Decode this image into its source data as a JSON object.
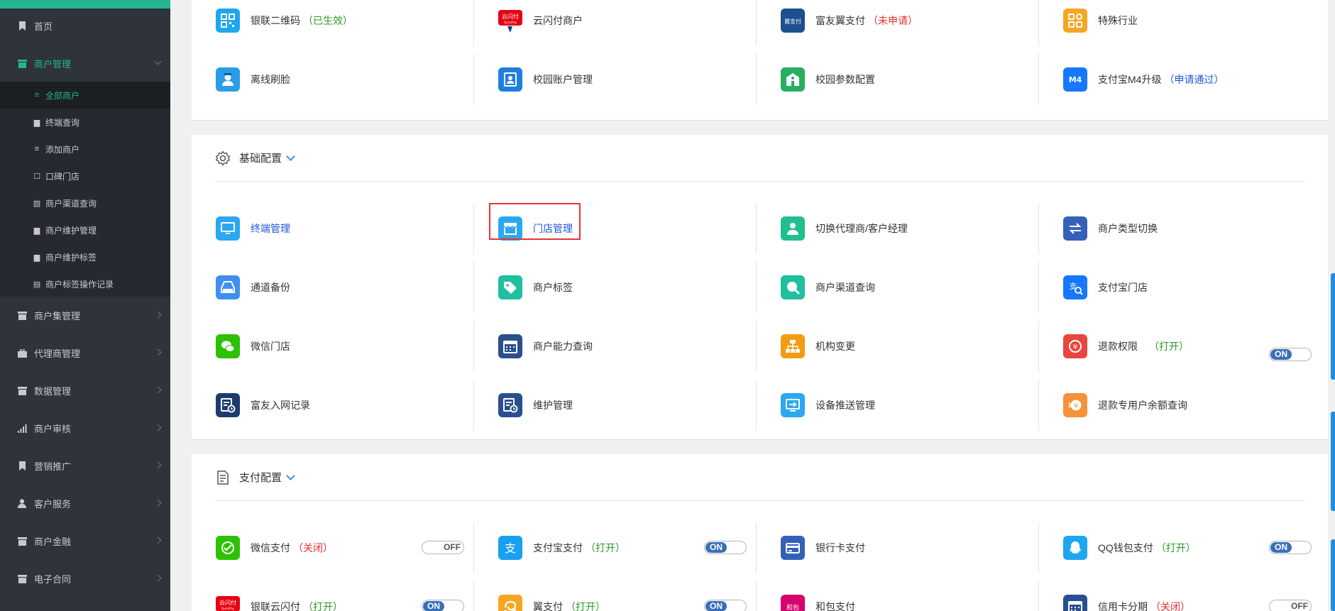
{
  "sidebar": {
    "items": [
      {
        "label": "首页",
        "icon": "bookmark-icon"
      },
      {
        "label": "商户管理",
        "icon": "store-icon"
      },
      {
        "label": "商户集管理",
        "icon": "store-icon"
      },
      {
        "label": "代理商管理",
        "icon": "briefcase-icon"
      },
      {
        "label": "数据管理",
        "icon": "store-icon"
      },
      {
        "label": "商户审核",
        "icon": "signal-icon"
      },
      {
        "label": "营销推广",
        "icon": "bookmark-icon"
      },
      {
        "label": "客户服务",
        "icon": "user-icon"
      },
      {
        "label": "商户金融",
        "icon": "store-icon"
      },
      {
        "label": "电子合同",
        "icon": "store-icon"
      }
    ],
    "subitems": [
      {
        "label": "全部商户",
        "icon": "list-icon"
      },
      {
        "label": "终端查询",
        "icon": "store-icon"
      },
      {
        "label": "添加商户",
        "icon": "list-icon"
      },
      {
        "label": "口碑门店",
        "icon": "square-icon"
      },
      {
        "label": "商户渠道查询",
        "icon": "image-icon"
      },
      {
        "label": "商户维护管理",
        "icon": "store-icon"
      },
      {
        "label": "商户维护标签",
        "icon": "store-icon"
      },
      {
        "label": "商户标签操作记录",
        "icon": "file-icon"
      }
    ]
  },
  "top_section": {
    "cells": [
      {
        "label": "银联二维码",
        "status": "（已生效）",
        "status_color": "green",
        "icon": "qrcode-icon",
        "color": "#1ea7f0"
      },
      {
        "label": "云闪付商户",
        "status": "",
        "icon": "unionpay-icon",
        "color": "#e60012"
      },
      {
        "label": "富友翼支付",
        "status": "（未申请）",
        "status_color": "red",
        "icon": "bestpay-icon",
        "color": "#1d4f91"
      },
      {
        "label": "特殊行业",
        "status": "",
        "icon": "grid-icon",
        "color": "#f5a623"
      },
      {
        "label": "离线刷脸",
        "status": "",
        "icon": "face-icon",
        "color": "#2a9de8"
      },
      {
        "label": "校园账户管理",
        "status": "",
        "icon": "contact-card-icon",
        "color": "#1e7fe0"
      },
      {
        "label": "校园参数配置",
        "status": "",
        "icon": "school-icon",
        "color": "#27ae60"
      },
      {
        "label": "支付宝M4升级",
        "status": "（申请通过）",
        "status_color": "blue",
        "icon": "m4-icon",
        "color": "#1677ff"
      }
    ]
  },
  "basic_section": {
    "title": "基础配置",
    "icon": "gear-icon",
    "cells": [
      {
        "label": "终端管理",
        "link": true,
        "icon": "monitor-icon",
        "color": "#2aa8f2"
      },
      {
        "label": "门店管理",
        "link": true,
        "icon": "shop-icon",
        "color": "#2aa8f2"
      },
      {
        "label": "切换代理商/客户经理",
        "icon": "person-icon",
        "color": "#1fbf8f"
      },
      {
        "label": "商户类型切换",
        "icon": "swap-icon",
        "color": "#3461b8"
      },
      {
        "label": "通道备份",
        "icon": "drive-icon",
        "color": "#3f8ff0"
      },
      {
        "label": "商户标签",
        "icon": "tag-icon",
        "color": "#1fbf9f"
      },
      {
        "label": "商户渠道查询",
        "icon": "search-icon",
        "color": "#1fbf9f"
      },
      {
        "label": "支付宝门店",
        "icon": "alipay-search-icon",
        "color": "#1677ff"
      },
      {
        "label": "微信门店",
        "icon": "wechat-icon",
        "color": "#2dc100"
      },
      {
        "label": "商户能力查询",
        "icon": "calendar-icon",
        "color": "#2b4f8e"
      },
      {
        "label": "机构变更",
        "icon": "org-chart-icon",
        "color": "#f39c12"
      },
      {
        "label": "退款权限",
        "status": "（打开）",
        "status_color": "green",
        "toggle": "ON",
        "icon": "refund-icon",
        "color": "#e9463d"
      },
      {
        "label": "富友入网记录",
        "icon": "record-icon",
        "color": "#1d3c6e"
      },
      {
        "label": "维护管理",
        "icon": "record-icon",
        "color": "#2b4f8e"
      },
      {
        "label": "设备推送管理",
        "icon": "push-icon",
        "color": "#2aa8f2"
      },
      {
        "label": "退款专用户余额查询",
        "icon": "refund-balance-icon",
        "color": "#f5923a"
      }
    ]
  },
  "pay_section": {
    "title": "支付配置",
    "icon": "document-icon",
    "cells": [
      {
        "label": "微信支付",
        "status": "（关闭）",
        "status_color": "red",
        "toggle": "OFF",
        "icon": "wechat-pay-icon",
        "color": "#2dc100"
      },
      {
        "label": "支付宝支付",
        "status": "（打开）",
        "status_color": "green",
        "toggle": "ON",
        "icon": "alipay-icon",
        "color": "#1aa0f0"
      },
      {
        "label": "银行卡支付",
        "icon": "bank-card-icon",
        "color": "#3461b8"
      },
      {
        "label": "QQ钱包支付",
        "status": "（打开）",
        "status_color": "green",
        "toggle": "ON",
        "icon": "qq-icon",
        "color": "#1ea7f0"
      },
      {
        "label": "银联云闪付",
        "status": "（打开）",
        "status_color": "green",
        "toggle": "ON",
        "icon": "unionpay-icon",
        "color": "#e60012"
      },
      {
        "label": "翼支付",
        "status": "（打开）",
        "status_color": "green",
        "toggle": "ON",
        "icon": "bestpay-swirl-icon",
        "color": "#f5a623"
      },
      {
        "label": "和包支付",
        "icon": "hebao-icon",
        "color": "#d6006e"
      },
      {
        "label": "信用卡分期",
        "status": "（关闭）",
        "status_color": "red",
        "toggle": "OFF",
        "icon": "calendar-icon",
        "color": "#2b4f8e"
      }
    ]
  }
}
